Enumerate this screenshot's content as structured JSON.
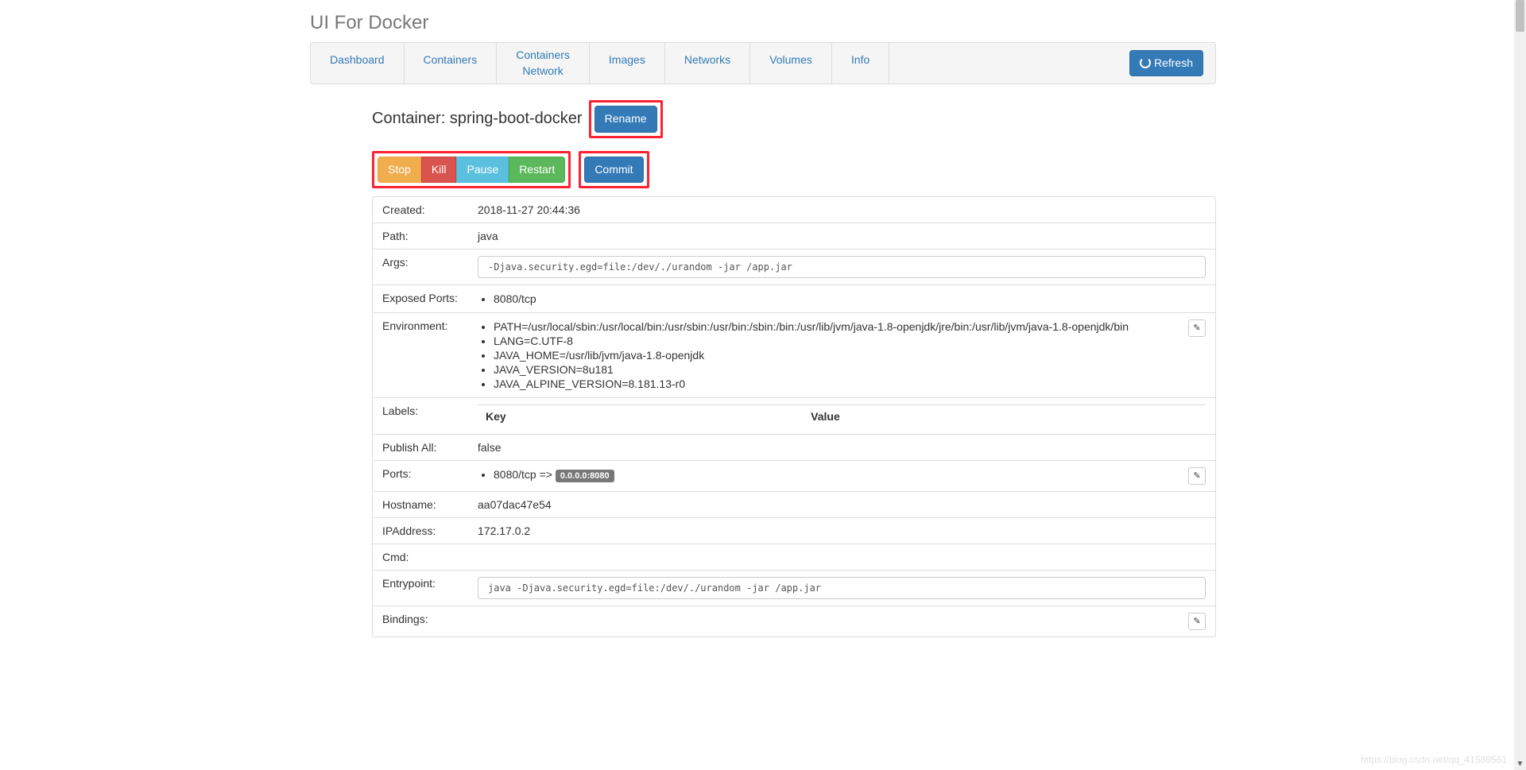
{
  "app": {
    "title": "UI For Docker"
  },
  "nav": {
    "tabs": [
      {
        "label": "Dashboard"
      },
      {
        "label": "Containers"
      },
      {
        "label_line1": "Containers",
        "label_line2": "Network"
      },
      {
        "label": "Images"
      },
      {
        "label": "Networks"
      },
      {
        "label": "Volumes"
      },
      {
        "label": "Info"
      }
    ],
    "refresh_label": "Refresh"
  },
  "header": {
    "prefix": "Container: ",
    "name": "spring-boot-docker",
    "rename_label": "Rename"
  },
  "actions": {
    "stop": "Stop",
    "kill": "Kill",
    "pause": "Pause",
    "restart": "Restart",
    "commit": "Commit"
  },
  "details": {
    "created": {
      "label": "Created:",
      "value": "2018-11-27 20:44:36"
    },
    "path": {
      "label": "Path:",
      "value": "java"
    },
    "args": {
      "label": "Args:",
      "value": "-Djava.security.egd=file:/dev/./urandom -jar /app.jar"
    },
    "exposed_ports": {
      "label": "Exposed Ports:",
      "items": [
        "8080/tcp"
      ]
    },
    "environment": {
      "label": "Environment:",
      "items": [
        "PATH=/usr/local/sbin:/usr/local/bin:/usr/sbin:/usr/bin:/sbin:/bin:/usr/lib/jvm/java-1.8-openjdk/jre/bin:/usr/lib/jvm/java-1.8-openjdk/bin",
        "LANG=C.UTF-8",
        "JAVA_HOME=/usr/lib/jvm/java-1.8-openjdk",
        "JAVA_VERSION=8u181",
        "JAVA_ALPINE_VERSION=8.181.13-r0"
      ]
    },
    "labels": {
      "label": "Labels:",
      "key_header": "Key",
      "value_header": "Value"
    },
    "publish_all": {
      "label": "Publish All:",
      "value": "false"
    },
    "ports": {
      "label": "Ports:",
      "item_prefix": "8080/tcp => ",
      "badge": "0.0.0.0:8080"
    },
    "hostname": {
      "label": "Hostname:",
      "value": "aa07dac47e54"
    },
    "ipaddress": {
      "label": "IPAddress:",
      "value": "172.17.0.2"
    },
    "cmd": {
      "label": "Cmd:",
      "value": ""
    },
    "entrypoint": {
      "label": "Entrypoint:",
      "value": "java -Djava.security.egd=file:/dev/./urandom -jar /app.jar"
    },
    "bindings": {
      "label": "Bindings:"
    }
  },
  "watermark": "https://blog.csdn.net/qq_41589561"
}
